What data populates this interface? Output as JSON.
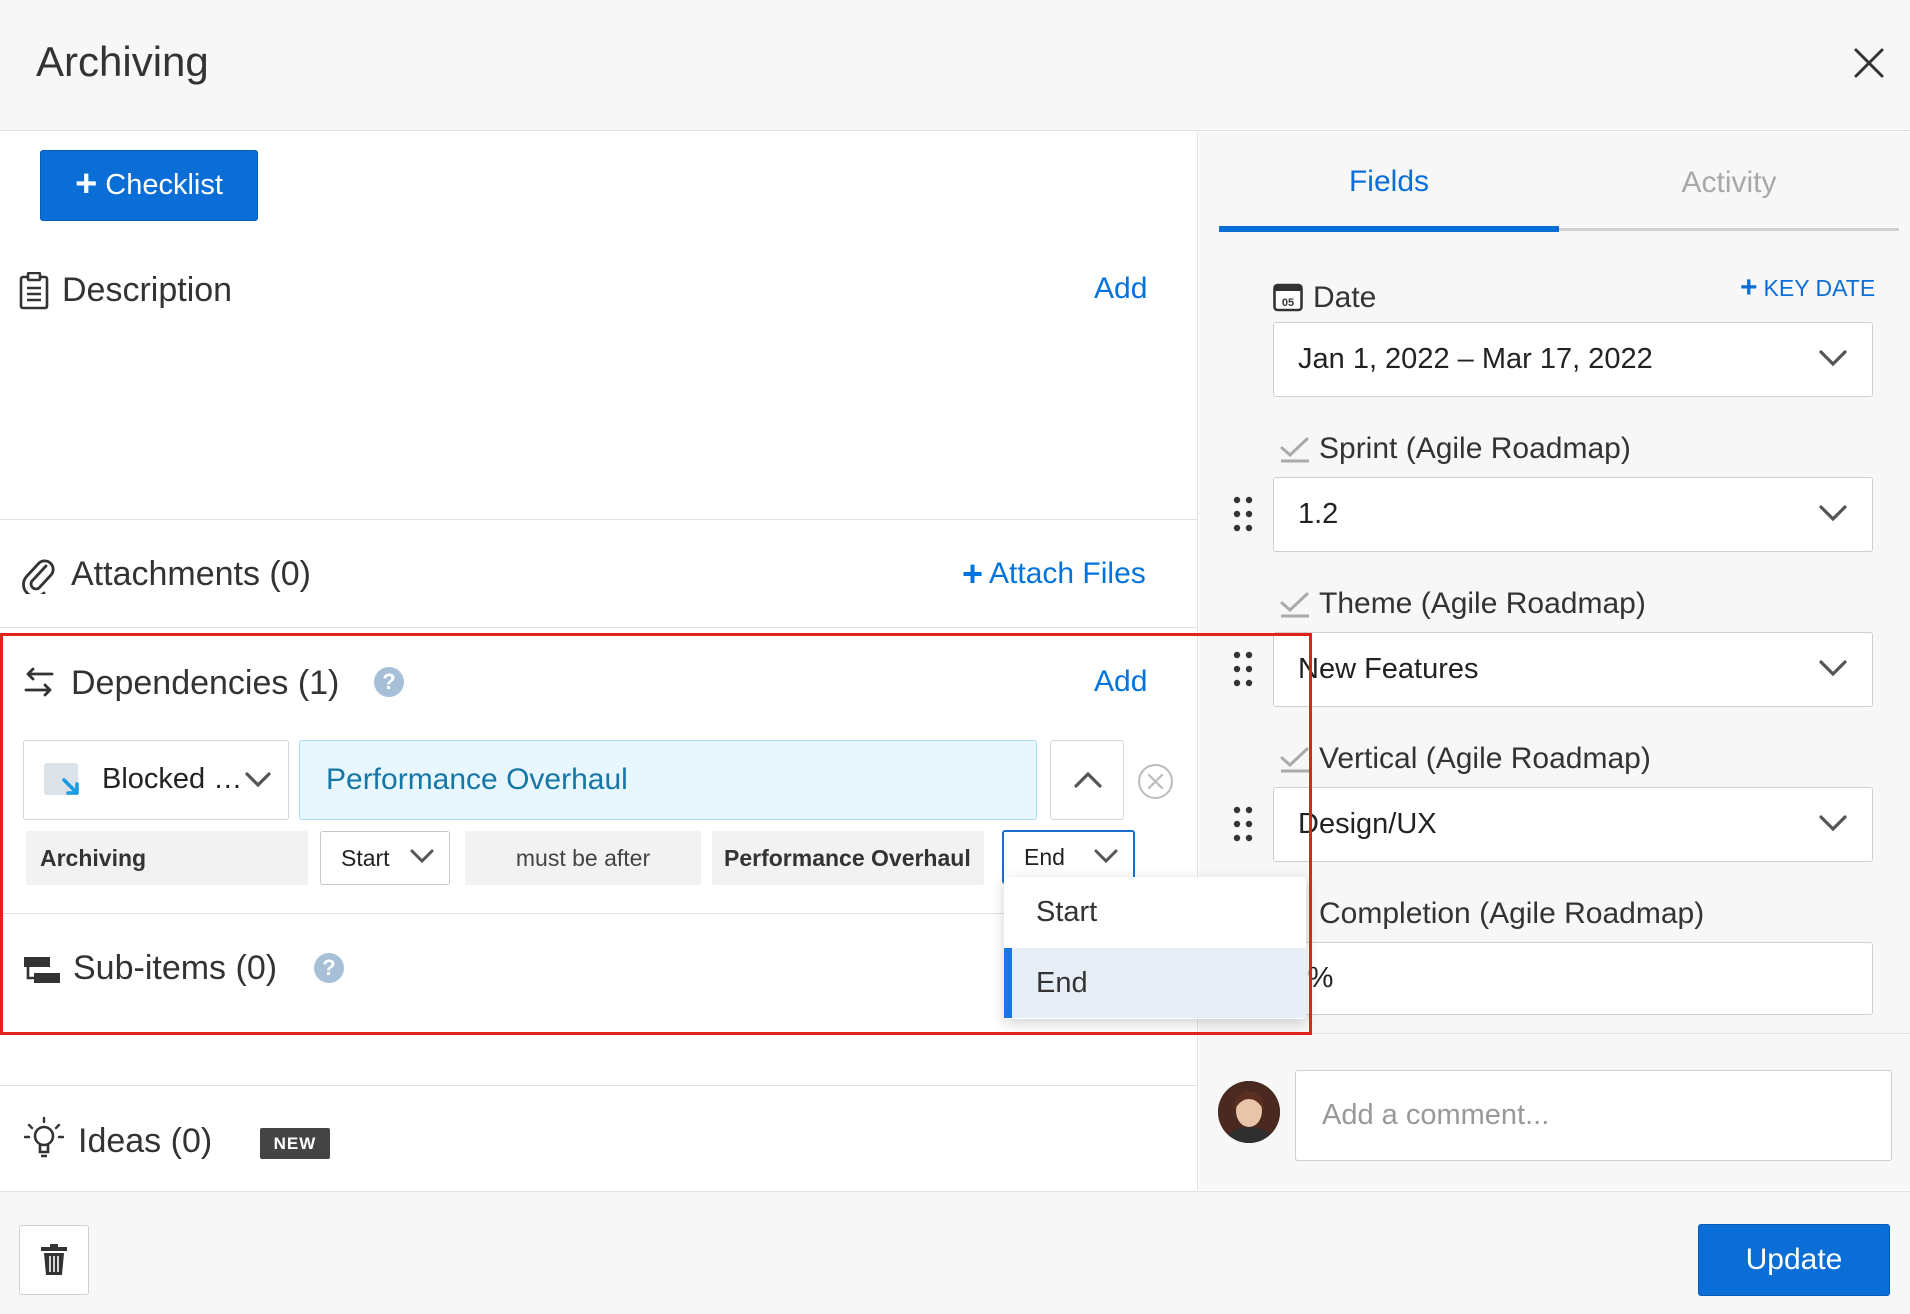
{
  "header": {
    "title": "Archiving",
    "close_icon": "close-icon"
  },
  "left": {
    "checklist_button": {
      "plus": "+",
      "label": "Checklist"
    },
    "description": {
      "title": "Description",
      "add": "Add",
      "icon": "clipboard-icon"
    },
    "attachments": {
      "title": "Attachments (0)",
      "attach": "Attach Files",
      "plus": "+",
      "icon": "paperclip-icon"
    },
    "dependencies": {
      "title": "Dependencies (1)",
      "help": "?",
      "add": "Add",
      "icon": "dependency-arrows-icon",
      "type_select": "Blocked …",
      "target": "Performance Overhaul",
      "constraint": {
        "source": "Archiving",
        "source_point": "Start",
        "relation": "must be after",
        "target": "Performance Overhaul",
        "target_point": "End"
      },
      "menu_options": [
        "Start",
        "End"
      ],
      "menu_selected": "End"
    },
    "sub_items": {
      "title": "Sub-items (0)",
      "help": "?",
      "icon": "sub-items-icon"
    },
    "ideas": {
      "title": "Ideas (0)",
      "badge": "NEW",
      "icon": "lightbulb-icon"
    }
  },
  "right": {
    "tabs": [
      {
        "label": "Fields",
        "active": true
      },
      {
        "label": "Activity",
        "active": false
      }
    ],
    "date": {
      "label": "Date",
      "key_date": "KEY DATE",
      "plus": "+",
      "value": "Jan 1, 2022 – Mar 17, 2022",
      "icon_text": "05"
    },
    "sprint": {
      "label": "Sprint (Agile Roadmap)",
      "value": "1.2"
    },
    "theme": {
      "label": "Theme (Agile Roadmap)",
      "value": "New Features"
    },
    "vertical": {
      "label": "Vertical (Agile Roadmap)",
      "value": "Design/UX"
    },
    "completion": {
      "label": "Completion (Agile Roadmap)",
      "value": ")%"
    },
    "comment_placeholder": "Add a comment..."
  },
  "footer": {
    "update": "Update",
    "trash_icon": "trash-icon"
  },
  "colors": {
    "accent": "#0a6ed6",
    "highlight": "#e2231a",
    "target_fill": "#e8f6fd"
  }
}
